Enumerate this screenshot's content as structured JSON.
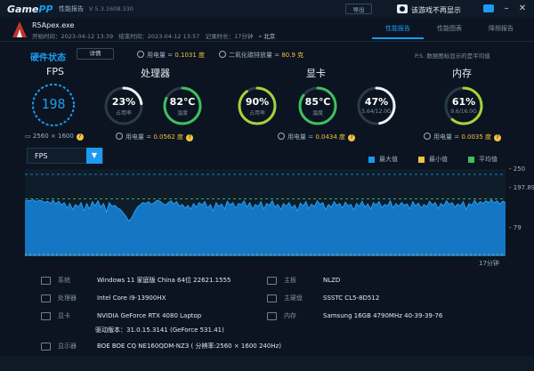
{
  "titlebar": {
    "logo_main": "Game",
    "logo_accent": "PP",
    "title": "性能报告",
    "version": "V 5.3.1608.330",
    "return_label": "导出",
    "hide_label": "该游戏不再显示"
  },
  "game": {
    "exe": "R5Apex.exe",
    "start_label": "开始时间：",
    "start": "2023-04-12 13:39",
    "end_label": "结束时间：",
    "end": "2023-04-12 13:57",
    "duration_label": "记录时长：",
    "duration": "17分钟",
    "location": "北京"
  },
  "tabs": [
    {
      "label": "性能报告",
      "active": true
    },
    {
      "label": "性能图表",
      "active": false
    },
    {
      "label": "降频报告",
      "active": false
    }
  ],
  "hardware": {
    "title": "硬件状态",
    "detail_button": "详情",
    "power_label": "用电量 =",
    "power_value": "0.1031 度",
    "carbon_label": "二氧化碳排放量 =",
    "carbon_value": "80.9 克",
    "ps_note": "P.S. 数据图标显示的是平均值"
  },
  "fps": {
    "label": "FPS",
    "value": "198",
    "resolution": "2560 × 1600"
  },
  "cpu": {
    "label": "处理器",
    "usage": "23%",
    "usage_sub": "占用率",
    "temp": "82℃",
    "temp_sub": "温度",
    "power_label": "用电量 =",
    "power": "0.0562 度",
    "usage_pct": 23,
    "temp_pct": 82
  },
  "gpu": {
    "label": "显卡",
    "usage": "90%",
    "usage_sub": "占用率",
    "temp": "85℃",
    "temp_sub": "温度",
    "vram": "47%",
    "vram_sub": "5.64/12.0G",
    "power_label": "用电量 =",
    "power": "0.0434 度",
    "usage_pct": 90,
    "temp_pct": 85,
    "vram_pct": 47
  },
  "memory": {
    "label": "内存",
    "usage": "61%",
    "usage_sub": "9.6/16.0G",
    "power_label": "用电量 =",
    "power": "0.0035 度",
    "usage_pct": 61
  },
  "chart_header": {
    "metric": "FPS",
    "legend": [
      {
        "label": "最大值",
        "color": "#1c9bf0"
      },
      {
        "label": "最小值",
        "color": "#f5c242"
      },
      {
        "label": "平均值",
        "color": "#3fbf5f"
      }
    ]
  },
  "chart_data": {
    "type": "area",
    "title": "",
    "series": [
      {
        "name": "FPS",
        "values": [
          193,
          195,
          194,
          196,
          192,
          195,
          194,
          190,
          193,
          188,
          195,
          187,
          193,
          185,
          190,
          178,
          188,
          175,
          186,
          180,
          190,
          172,
          188,
          176,
          192,
          183,
          194,
          180,
          188,
          170,
          190,
          182,
          184,
          178,
          175,
          168,
          160,
          150,
          158,
          170,
          180,
          185,
          190,
          188,
          192,
          186,
          190,
          195,
          193,
          188,
          185,
          190,
          194,
          187,
          192,
          182,
          186,
          178,
          184,
          176,
          188,
          180,
          190,
          185,
          192,
          178,
          186,
          172,
          190,
          182,
          187,
          176,
          193,
          185,
          190,
          178,
          188,
          186,
          194,
          180,
          190,
          176,
          186,
          182,
          192,
          176,
          188,
          184,
          194,
          180,
          186,
          175,
          188,
          182,
          190,
          178,
          185,
          172,
          189,
          183,
          192,
          177,
          187,
          181,
          194,
          186,
          190,
          175,
          186,
          180,
          192,
          184,
          188,
          178,
          191,
          183,
          186,
          174,
          188,
          182,
          193,
          180,
          187,
          176,
          190,
          185,
          192,
          179,
          186,
          183,
          194,
          178,
          188,
          182,
          190,
          184,
          187,
          176,
          192,
          183,
          189,
          178,
          186,
          181,
          193,
          185,
          190,
          177,
          188,
          183,
          194,
          186,
          190,
          180,
          187,
          183,
          192,
          175,
          188,
          184,
          195,
          186,
          192,
          188,
          194,
          190,
          196,
          189,
          194,
          187,
          193,
          190
        ]
      }
    ],
    "ylim": [
      79,
      250
    ],
    "y_ticks": [
      "250",
      "197.89",
      "79"
    ],
    "max": 250,
    "min": 79,
    "avg": 197.89,
    "x_end_label": "17分钟"
  },
  "sysinfo": [
    {
      "key": "系统",
      "value": "Windows 11 家庭版 China 64位 22621.1555"
    },
    {
      "key": "主板",
      "value": "NLZD"
    },
    {
      "key": "处理器",
      "value": "Intel Core i9-13900HX"
    },
    {
      "key": "主硬盘",
      "value": "SSSTC CL5-8D512"
    },
    {
      "key": "显卡",
      "value": "NVIDIA GeForce RTX 4080 Laptop"
    },
    {
      "key": "内存",
      "value": "Samsung 16GB 4790MHz 40-39-39-76"
    },
    {
      "key": "",
      "value": "驱动版本：31.0.15.3141 (GeForce 531.41)"
    },
    {
      "key": "显示器",
      "value": "BOE BOE CQ NE160QDM-NZ3 ( 分辨率:2560 × 1600 240Hz)"
    }
  ]
}
